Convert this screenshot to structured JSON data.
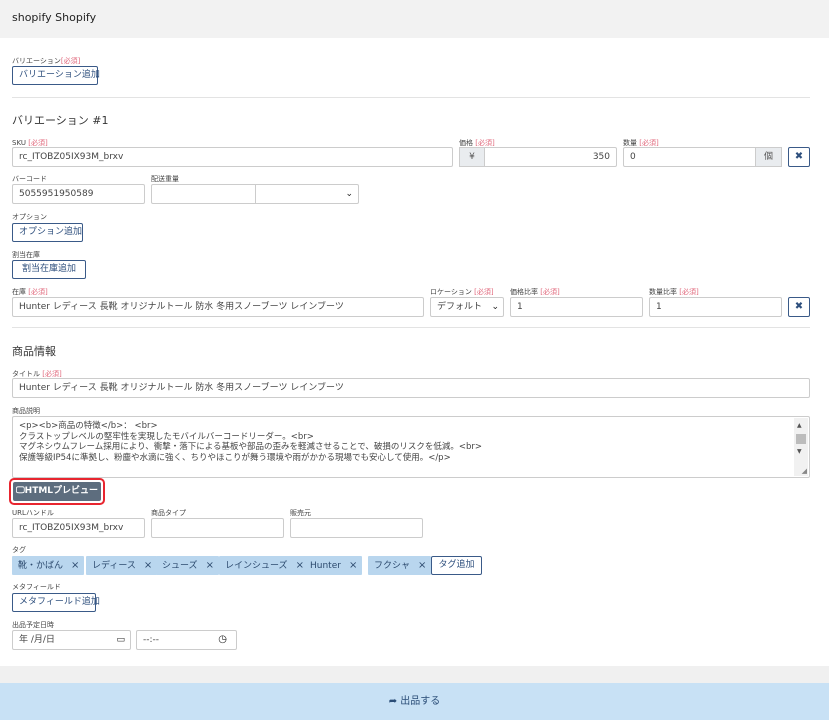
{
  "header": {
    "brand": "shopify",
    "store": "Shopify"
  },
  "variation_section": {
    "label": "バリエーション",
    "required": "[必須]",
    "add_button": "バリエーション追加"
  },
  "variation1": {
    "title": "バリエーション #1",
    "sku_label": "SKU",
    "sku_required": "[必須]",
    "sku_value": "rc_ITOBZ05IX93M_brxv",
    "price_label": "価格",
    "price_required": "[必須]",
    "price_currency": "¥",
    "price_value": "350",
    "qty_label": "数量",
    "qty_required": "[必須]",
    "qty_value": "0",
    "qty_unit": "個",
    "barcode_label": "バーコード",
    "barcode_value": "5055951950589",
    "shipping_weight_label": "配送重量",
    "option_label": "オプション",
    "option_button": "オプション追加",
    "allocated_stock_label": "割当在庫",
    "allocated_stock_button": "割当在庫追加",
    "stock_label": "在庫",
    "stock_required": "[必須]",
    "stock_value": "Hunter レディース 長靴 オリジナルトール 防水 冬用スノーブーツ レインブーツ",
    "location_label": "ロケーション",
    "location_required": "[必須]",
    "location_value": "デフォルト",
    "price_ratio_label": "価格比率",
    "price_ratio_required": "[必須]",
    "price_ratio_value": "1",
    "qty_ratio_label": "数量比率",
    "qty_ratio_required": "[必須]",
    "qty_ratio_value": "1"
  },
  "product": {
    "section_title": "商品情報",
    "title_label": "タイトル",
    "title_required": "[必須]",
    "title_value": "Hunter レディース 長靴 オリジナルトール 防水 冬用スノーブーツ レインブーツ",
    "desc_label": "商品説明",
    "desc_lines": [
      "<p><b>商品の特徴</b>： <br>",
      "クラストップレベルの堅牢性を実現したモバイルバーコードリーダー。<br>",
      "マグネシウムフレーム採用により、衝撃・落下による基板や部品の歪みを軽減させることで、破損のリスクを低減。<br>",
      "保護等級IP54に準拠し、粉塵や水滴に強く、ちりやほこりが舞う環境や雨がかかる現場でも安心して使用。</p>"
    ],
    "html_preview_button": "HTMLプレビュー",
    "url_handle_label": "URLハンドル",
    "url_handle_value": "rc_ITOBZ05IX93M_brxv",
    "product_type_label": "商品タイプ",
    "vendor_label": "販売元",
    "tags_label": "タグ",
    "tags": [
      "靴・かばん",
      "レディース",
      "シューズ",
      "レインシューズ",
      "Hunter",
      "フクシャ"
    ],
    "tag_remove": "×",
    "add_tag_button": "タグ追加",
    "metafield_label": "メタフィールド",
    "metafield_button": "メタフィールド追加",
    "schedule_label": "出品予定日時",
    "date_placeholder": "年 /月/日",
    "time_placeholder": "--:--"
  },
  "footer": {
    "submit_label": "出品する"
  },
  "colors": {
    "accent": "#2e4f7d",
    "required": "#e0667a",
    "tag_bg": "#b9d6ee",
    "footer_bg": "#c8e1f5",
    "highlight": "#e8252f"
  }
}
